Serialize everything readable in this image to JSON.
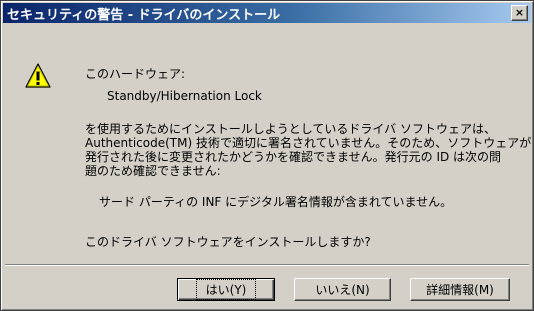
{
  "window": {
    "title": "セキュリティの警告 - ドライバのインストール",
    "close_label": "×"
  },
  "content": {
    "line1": "このハードウェア:",
    "device_name": "Standby/Hibernation Lock",
    "body_lines": [
      "を使用するためにインストールしようとしているドライバ ソフトウェアは、",
      "Authenticode(TM) 技術で適切に署名されていません。そのため、ソフトウェアが",
      "発行された後に変更されたかどうかを確認できません。発行元の ID は次の問",
      "題のため確認できません:"
    ],
    "reason": "サード パーティの INF にデジタル署名情報が含まれていません。",
    "question": "このドライバ ソフトウェアをインストールしますか?"
  },
  "buttons": {
    "yes": "はい(Y)",
    "no": "いいえ(N)",
    "details": "詳細情報(M)"
  },
  "icons": {
    "warning": "warning-icon"
  }
}
